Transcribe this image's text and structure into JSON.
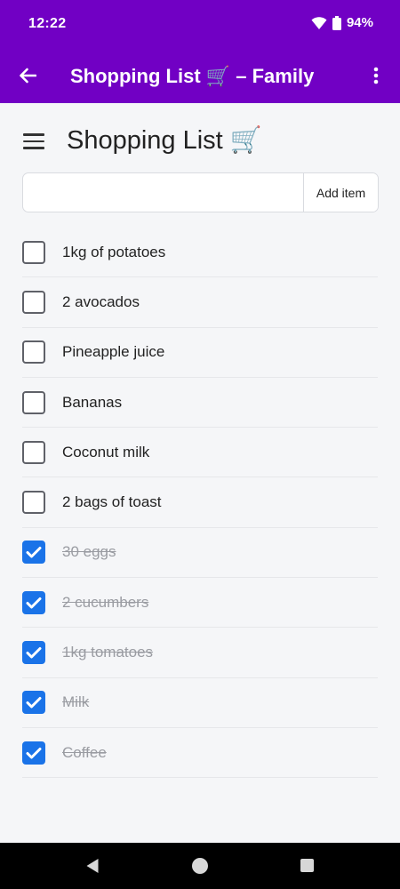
{
  "status_bar": {
    "time": "12:22",
    "battery": "94%"
  },
  "app_bar": {
    "title": "Shopping List 🛒 – Family"
  },
  "page": {
    "title": "Shopping List 🛒"
  },
  "add_form": {
    "input_value": "",
    "button_label": "Add item"
  },
  "items": [
    {
      "label": "1kg of potatoes",
      "checked": false
    },
    {
      "label": "2 avocados",
      "checked": false
    },
    {
      "label": "Pineapple juice",
      "checked": false
    },
    {
      "label": "Bananas",
      "checked": false
    },
    {
      "label": "Coconut milk",
      "checked": false
    },
    {
      "label": "2 bags of toast",
      "checked": false
    },
    {
      "label": "30 eggs",
      "checked": true
    },
    {
      "label": "2 cucumbers",
      "checked": true
    },
    {
      "label": "1kg tomatoes",
      "checked": true
    },
    {
      "label": "Milk",
      "checked": true
    },
    {
      "label": "Coffee",
      "checked": true
    }
  ],
  "colors": {
    "app_bar": "#7100c4",
    "checkbox_checked": "#1a73e8"
  }
}
